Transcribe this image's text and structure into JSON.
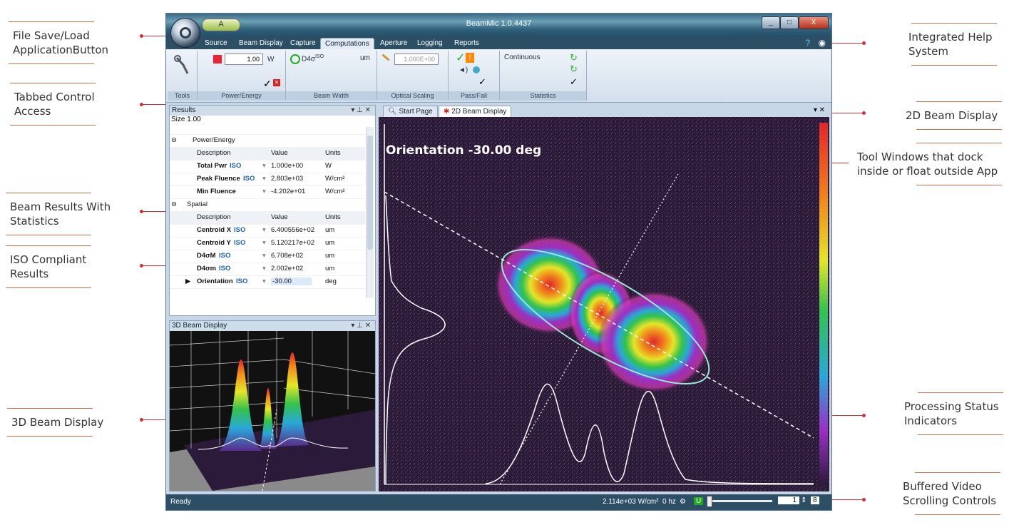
{
  "callouts": {
    "file_save": "File Save/Load\nApplicationButton",
    "tabbed": "Tabbed Control\nAccess",
    "beam_results": "Beam Results With\nStatistics",
    "iso": "ISO Compliant\nResults",
    "beam3d": "3D Beam Display",
    "help": "Integrated Help\nSystem",
    "beam2d": "2D Beam Display",
    "tool_windows": "Tool Windows that dock\ninside or float outside App",
    "processing": "Processing Status\nIndicators",
    "buffered": "Buffered Video\nScrolling Controls"
  },
  "window": {
    "title": "BeamMic 1.0.4437",
    "qat_label": "A",
    "minimize": "_",
    "maximize": "□",
    "close": "X"
  },
  "ribbon": {
    "tabs": [
      "Source",
      "Beam Display",
      "Capture",
      "Computations",
      "Aperture",
      "Logging",
      "Reports"
    ],
    "active_tab": "Computations",
    "groups": {
      "tools": "Tools",
      "power": "Power/Energy",
      "beamwidth": "Beam Width",
      "optical": "Optical Scaling",
      "passfail": "Pass/Fail",
      "statistics": "Statistics"
    },
    "power_value": "1.00",
    "power_unit": "W",
    "beamwidth_method": "D4σ",
    "beamwidth_sup": "ISO",
    "beamwidth_unit": "um",
    "optical_value": "1.000E+00",
    "statistics_mode": "Continuous"
  },
  "results": {
    "title": "Results",
    "size_label": "Size 1.00",
    "power_group": "Power/Energy",
    "spatial_group": "Spatial",
    "columns": [
      "Description",
      "Value",
      "Units"
    ],
    "power_rows": [
      {
        "desc": "Total Pwr",
        "iso": "ISO",
        "value": "1.000e+00",
        "units": "W"
      },
      {
        "desc": "Peak Fluence",
        "iso": "ISO",
        "value": "2.803e+03",
        "units": "W/cm²"
      },
      {
        "desc": "Min Fluence",
        "iso": "",
        "value": "-4.202e+01",
        "units": "W/cm²"
      }
    ],
    "spatial_rows": [
      {
        "desc": "Centroid X",
        "iso": "ISO",
        "value": "6.400556e+02",
        "units": "um"
      },
      {
        "desc": "Centroid Y",
        "iso": "ISO",
        "value": "5.120217e+02",
        "units": "um"
      },
      {
        "desc": "D4σM",
        "iso": "ISO",
        "value": "6.708e+02",
        "units": "um"
      },
      {
        "desc": "D4σm",
        "iso": "ISO",
        "value": "2.002e+02",
        "units": "um"
      },
      {
        "desc": "Orientation",
        "iso": "ISO",
        "value": "-30.00",
        "units": "deg"
      }
    ]
  },
  "panel3d": {
    "title": "3D Beam Display"
  },
  "doc_tabs": [
    "Start Page",
    "2D Beam Display"
  ],
  "display2d": {
    "overlay": "Orientation -30.00 deg"
  },
  "status": {
    "ready": "Ready",
    "fluence": "2.114e+03 W/cm²",
    "rate": "0 hz",
    "u_badge": "U",
    "frame": "1",
    "frame_max": "8"
  }
}
